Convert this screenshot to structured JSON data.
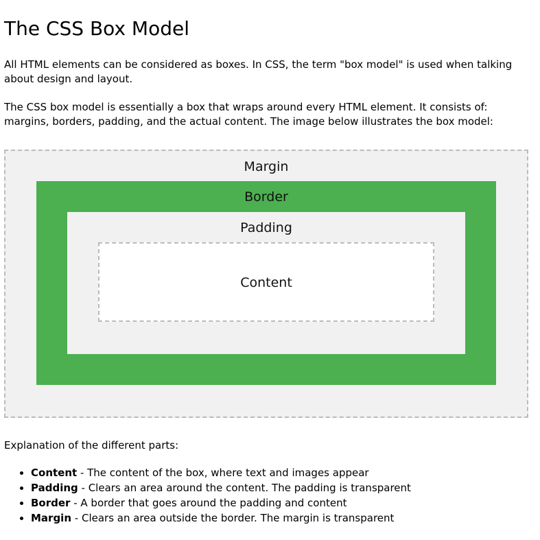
{
  "title": "The CSS Box Model",
  "intro": "All HTML elements can be considered as boxes. In CSS, the term \"box model\" is used when talking about design and layout.",
  "description": "The CSS box model is essentially a box that wraps around every HTML element. It consists of: margins, borders, padding, and the actual content. The image below illustrates the box model:",
  "diagram": {
    "margin_label": "Margin",
    "border_label": "Border",
    "padding_label": "Padding",
    "content_label": "Content",
    "colors": {
      "margin_bg": "#f1f1f1",
      "border_bg": "#4caf50",
      "padding_bg": "#f1f1f1",
      "content_bg": "#ffffff",
      "dashed_outline": "#bbbbbb"
    }
  },
  "explanation_heading": "Explanation of the different parts:",
  "parts": [
    {
      "term": "Content",
      "desc": " - The content of the box, where text and images appear"
    },
    {
      "term": "Padding",
      "desc": " - Clears an area around the content. The padding is transparent"
    },
    {
      "term": "Border",
      "desc": " - A border that goes around the padding and content"
    },
    {
      "term": "Margin",
      "desc": " - Clears an area outside the border. The margin is transparent"
    }
  ]
}
